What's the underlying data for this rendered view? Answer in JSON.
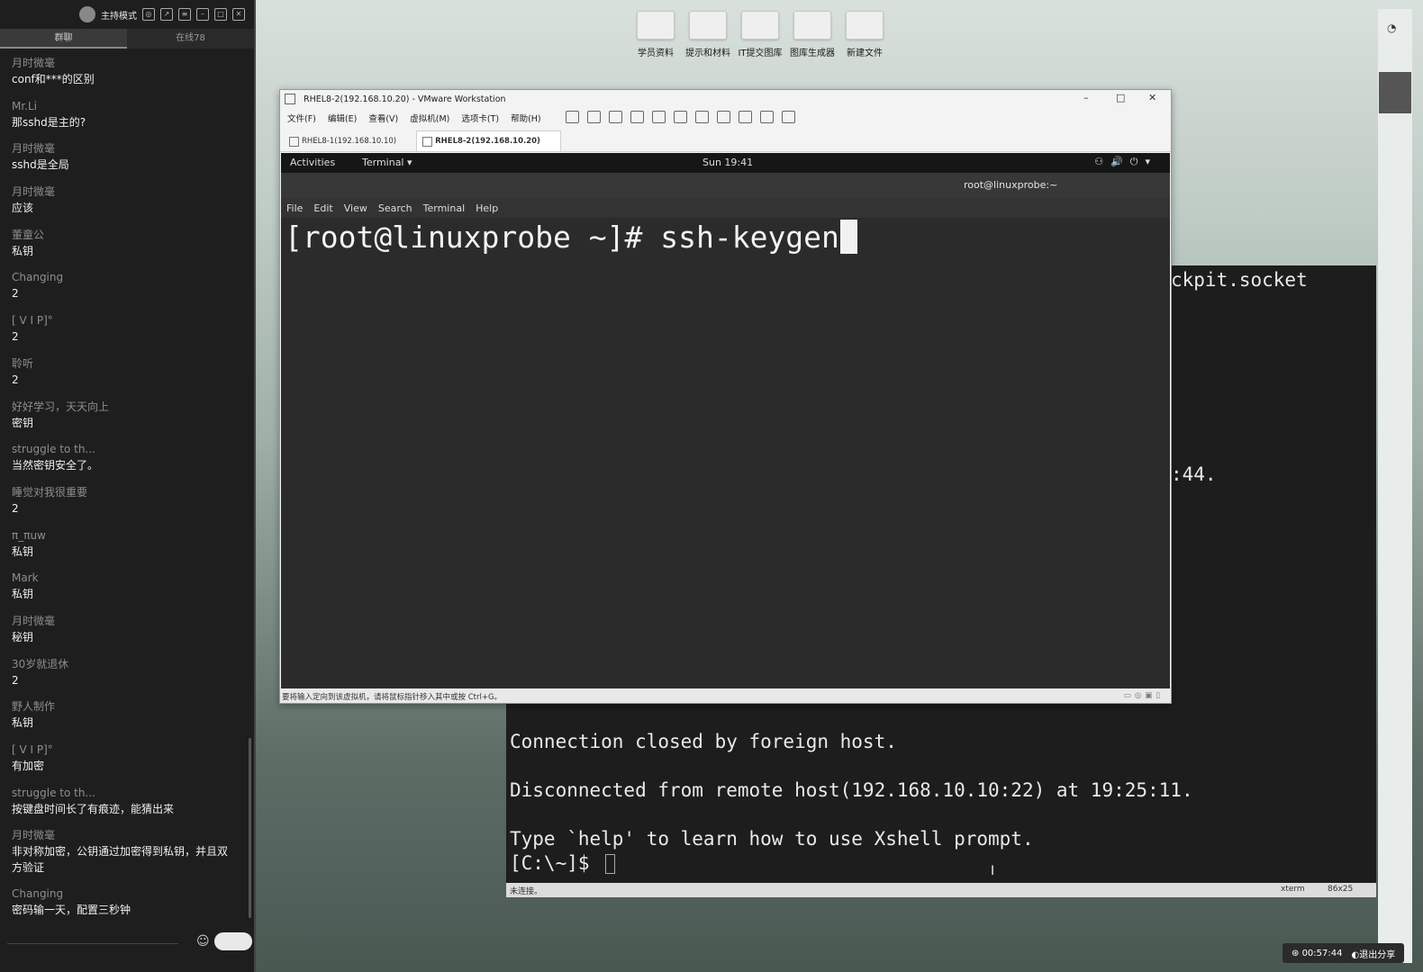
{
  "chat": {
    "mode_label": "主持模式",
    "tabs": [
      "群聊",
      "在线78"
    ],
    "messages": [
      {
        "user": "月时微毫",
        "text": "conf和***的区别"
      },
      {
        "user": "Mr.Li",
        "text": "那sshd是主的?"
      },
      {
        "user": "月时微毫",
        "text": "sshd是全局"
      },
      {
        "user": "月时微毫",
        "text": "应该"
      },
      {
        "user": "董童公",
        "text": "私钥"
      },
      {
        "user": "Changing",
        "text": "2"
      },
      {
        "user": "[ V I P]°",
        "text": "2"
      },
      {
        "user": "聆听",
        "text": "2"
      },
      {
        "user": "好好学习，天天向上",
        "text": "密钥"
      },
      {
        "user": "struggle to th...",
        "text": "当然密钥安全了。"
      },
      {
        "user": "睡觉对我很重要",
        "text": "2"
      },
      {
        "user": "π_πuw",
        "text": "私钥"
      },
      {
        "user": "Mark",
        "text": "私钥"
      },
      {
        "user": "月时微毫",
        "text": "秘钥"
      },
      {
        "user": "30岁就退休",
        "text": "2"
      },
      {
        "user": "野人制作",
        "text": "私钥"
      },
      {
        "user": "[ V I P]°",
        "text": "有加密"
      },
      {
        "user": "struggle to th...",
        "text": "按键盘时间长了有痕迹，能猜出来"
      },
      {
        "user": "月时微毫",
        "text": "非对称加密，公钥通过加密得到私钥，并且双方验证"
      },
      {
        "user": "Changing",
        "text": "密码输一天，配置三秒钟"
      }
    ]
  },
  "desktop_icons": [
    "学员资料",
    "提示和材料",
    "IT提交图库",
    "图库生成器",
    "新建文件"
  ],
  "vmware": {
    "title": "RHEL8-2(192.168.10.20) - VMware Workstation",
    "menu": [
      "文件(F)",
      "编辑(E)",
      "查看(V)",
      "虚拟机(M)",
      "选项卡(T)",
      "帮助(H)"
    ],
    "tabs": [
      "RHEL8-1(192.168.10.10)",
      "RHEL8-2(192.168.10.20)"
    ],
    "status_message": "要将输入定向到该虚拟机，请将鼠标指针移入其中或按 Ctrl+G。"
  },
  "gnome": {
    "activities": "Activities",
    "app_menu": "Terminal",
    "clock": "Sun 19:41"
  },
  "terminal": {
    "title": "root@linuxprobe:~",
    "menu": [
      "File",
      "Edit",
      "View",
      "Search",
      "Terminal",
      "Help"
    ],
    "prompt": "[root@linuxprobe ~]# ",
    "command": "ssh-keygen"
  },
  "xshell": {
    "line_socket": "ckpit.socket",
    "line_44": ":44.",
    "line_closed": "Connection closed by foreign host.",
    "line_disconnected": "Disconnected from remote host(192.168.10.10:22) at 19:25:11.",
    "line_help": "Type `help' to learn how to use Xshell prompt.",
    "line_prompt": "[C:\\~]$ ",
    "status_left": "未连接。",
    "status_term": "xterm",
    "status_size": "86x25"
  },
  "bottom": {
    "timer": "00:57:44",
    "stop_share": "退出分享"
  }
}
